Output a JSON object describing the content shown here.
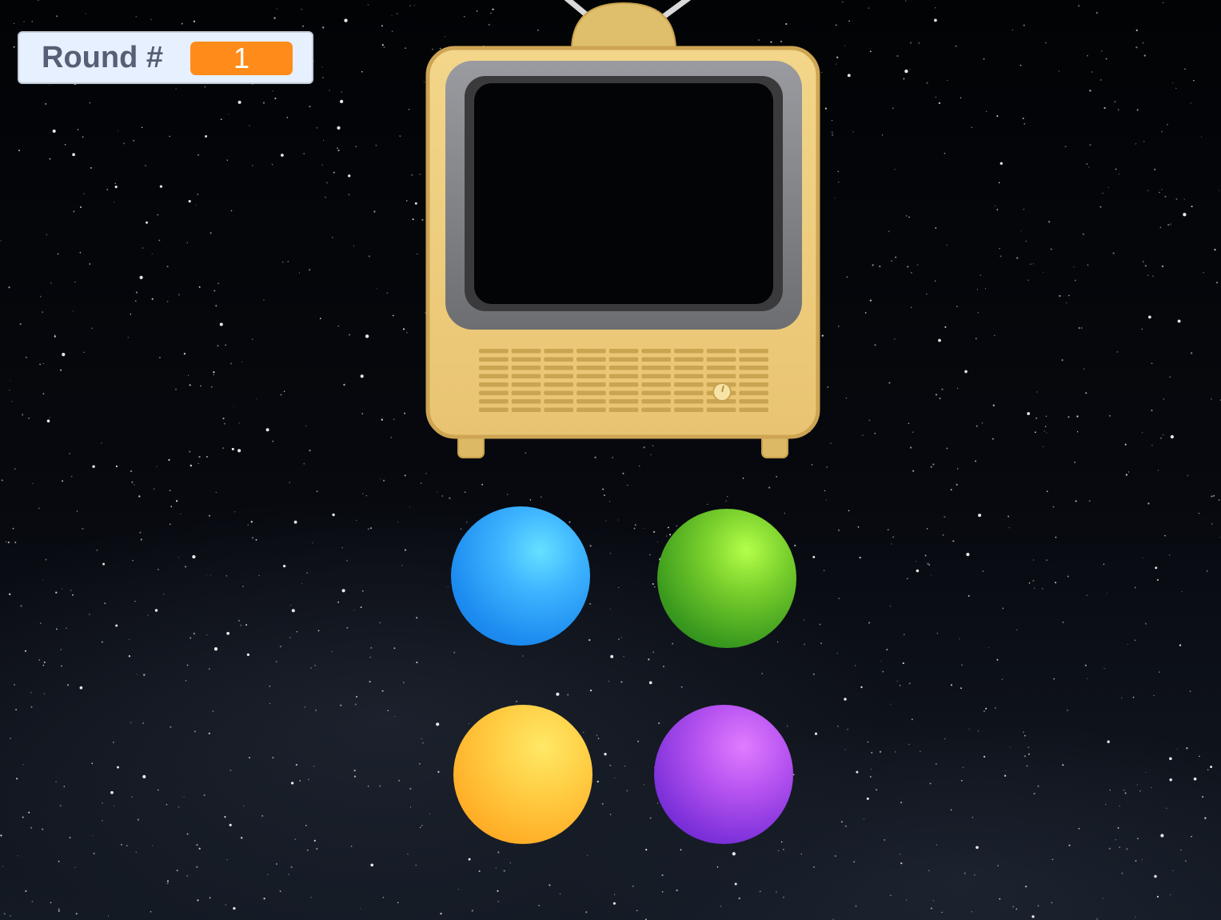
{
  "hud": {
    "round_label": "Round #",
    "round_value": "1",
    "value_color": "#ff8c1a"
  },
  "stage": {
    "background": "starry-night-space",
    "tv": "retro-tv-icon",
    "buttons": [
      {
        "name": "blue-button",
        "color": "#2a9df4"
      },
      {
        "name": "green-button",
        "color": "#4caf25"
      },
      {
        "name": "yellow-button",
        "color": "#ffbf2e"
      },
      {
        "name": "purple-button",
        "color": "#9b45e6"
      }
    ]
  }
}
